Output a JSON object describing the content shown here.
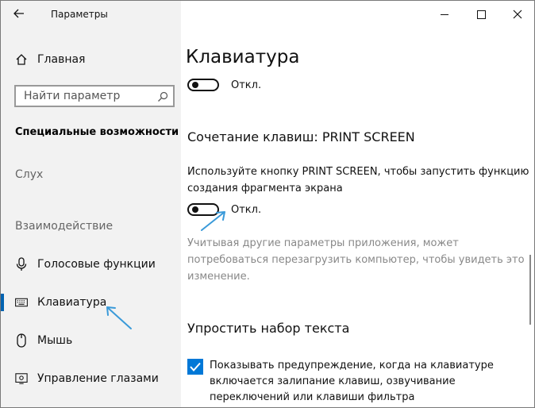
{
  "window": {
    "app_title": "Параметры"
  },
  "sidebar": {
    "home_label": "Главная",
    "search_placeholder": "Найти параметр",
    "section_title": "Специальные возможности",
    "group_hearing": "Слух",
    "group_interaction": "Взаимодействие",
    "items": [
      {
        "label": "Голосовые функции",
        "icon": "microphone-icon"
      },
      {
        "label": "Клавиатура",
        "icon": "keyboard-icon",
        "active": true
      },
      {
        "label": "Мышь",
        "icon": "mouse-icon"
      },
      {
        "label": "Управление глазами",
        "icon": "eye-icon"
      }
    ]
  },
  "content": {
    "page_title": "Клавиатура",
    "toggle1_label": "Откл.",
    "print_heading": "Сочетание клавиш: PRINT SCREEN",
    "print_description": "Используйте кнопку PRINT SCREEN, чтобы запустить функцию создания фрагмента экрана",
    "toggle2_label": "Откл.",
    "note": "Учитывая другие параметры приложения, может потребоваться перезагрузить компьютер, чтобы увидеть это изменение.",
    "simplify_heading": "Упростить набор текста",
    "checkbox_label": "Показывать предупреждение, когда на клавиатуре включается залипание клавиш, озвучивание переключений или клавиши фильтра",
    "checkbox_checked": true
  },
  "colors": {
    "accent": "#0078d7",
    "annotation_arrow": "#3a9ad9"
  }
}
